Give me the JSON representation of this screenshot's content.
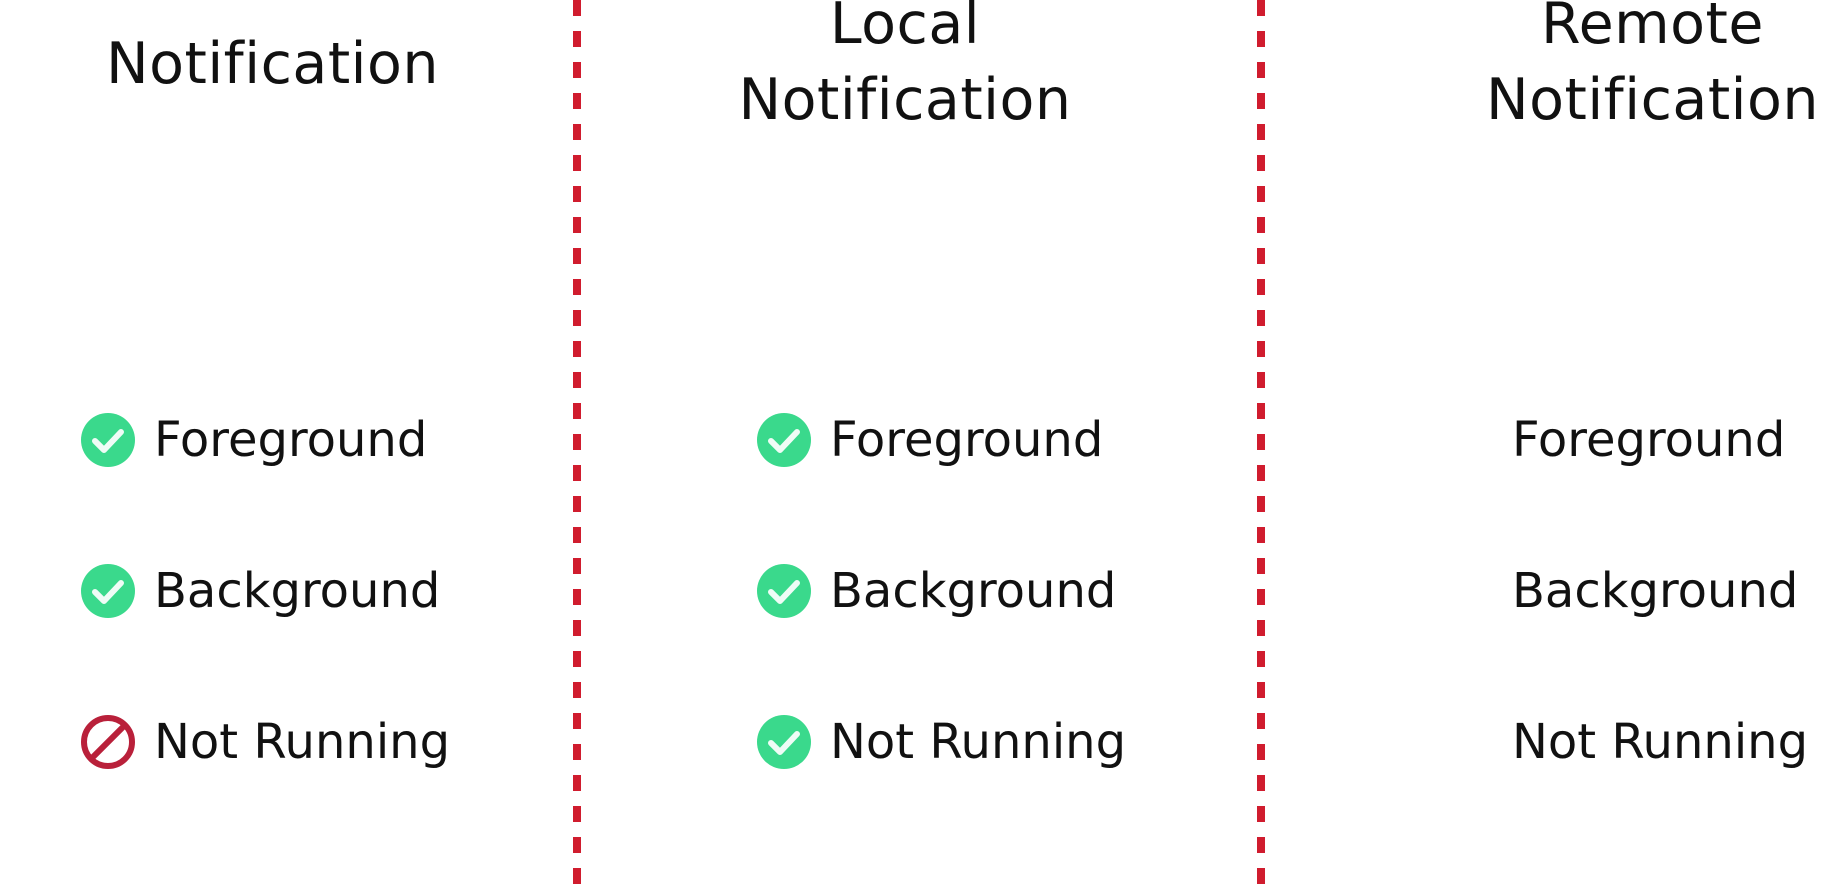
{
  "colors": {
    "check_green": "#3ad98c",
    "blocked_red": "#b9203a",
    "divider_red": "#d01c2e",
    "text": "#111111",
    "background": "#ffffff"
  },
  "columns": [
    {
      "title": "Notification",
      "rows": [
        {
          "label": "Foreground",
          "icon": "check-circle-icon"
        },
        {
          "label": "Background",
          "icon": "check-circle-icon"
        },
        {
          "label": "Not Running",
          "icon": "prohibited-icon"
        }
      ]
    },
    {
      "title": "Local\nNotification",
      "rows": [
        {
          "label": "Foreground",
          "icon": "check-circle-icon"
        },
        {
          "label": "Background",
          "icon": "check-circle-icon"
        },
        {
          "label": "Not Running",
          "icon": "check-circle-icon"
        }
      ]
    },
    {
      "title": "Remote\nNotification",
      "rows": [
        {
          "label": "Foreground",
          "icon": ""
        },
        {
          "label": "Background",
          "icon": ""
        },
        {
          "label": "Not Running",
          "icon": ""
        }
      ]
    }
  ]
}
